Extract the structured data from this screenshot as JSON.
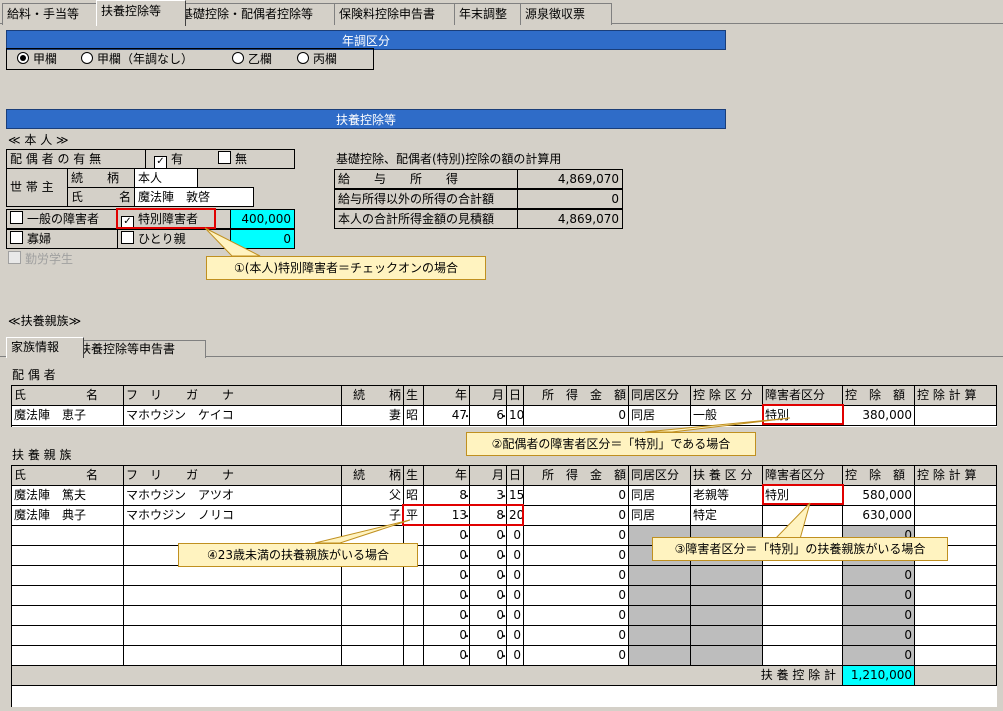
{
  "tabs": [
    "給料・手当等",
    "扶養控除等",
    "基礎控除・配偶者控除等",
    "保険料控除申告書",
    "年末調整",
    "源泉徴収票"
  ],
  "nenchou": {
    "header": "年調区分",
    "options": [
      "甲欄",
      "甲欄（年調なし）",
      "乙欄",
      "丙欄"
    ],
    "selected": "甲欄"
  },
  "fuyo_header": "扶養控除等",
  "honnin": {
    "section": "≪ 本 人 ≫",
    "spouse_label": "配 偶 者 の 有 無",
    "spouse_yes": "有",
    "spouse_no": "無",
    "setainushi": "世 帯 主",
    "zokugara_label": "続　　柄",
    "zokugara_value": "本人",
    "shimei_label": "氏　　　名",
    "shimei_value": "魔法陣　敦啓",
    "ippan_shougai": "一般の障害者",
    "tokubetsu_shougai": "特別障害者",
    "shougai_amount": "400,000",
    "kafu": "寡婦",
    "hitorioya": "ひとり親",
    "hitorioya_amount": "0",
    "kinrou": "勤労学生"
  },
  "calc": {
    "title": "基礎控除、配偶者(特別)控除の額の計算用",
    "rows": [
      {
        "label": "給　　与　　所　　得",
        "value": "4,869,070"
      },
      {
        "label": "給与所得以外の所得の合計額",
        "value": "0"
      },
      {
        "label": "本人の合計所得金額の見積額",
        "value": "4,869,070"
      }
    ]
  },
  "fuyo_shinzoku": "≪扶養親族≫",
  "subtabs": [
    "家族情報",
    "扶養控除等申告書"
  ],
  "spouse_section": {
    "title": "配 偶 者",
    "headers": [
      "氏　　　　　名",
      "フ　リ　　ガ　　ナ",
      "続　　柄",
      "生",
      "年",
      "月",
      "日",
      "所　得　金　額",
      "同居区分",
      "控 除 区 分",
      "障害者区分",
      "控　除　額",
      "控 除 計 算"
    ],
    "row": {
      "name": "魔法陣　恵子",
      "kana": "マホウジン　ケイコ",
      "rel": "妻",
      "era": "昭",
      "y": "47",
      "m": "6",
      "d": "10",
      "income": "0",
      "dokyo": "同居",
      "kubun": "一般",
      "shougai": "特別",
      "amount": "380,000",
      "calc": ""
    }
  },
  "dependents": {
    "title": "扶 養 親 族",
    "headers": [
      "氏　　　　　名",
      "フ　リ　　ガ　　ナ",
      "続　　柄",
      "生",
      "年",
      "月",
      "日",
      "所　得　金　額",
      "同居区分",
      "扶 養 区 分",
      "障害者区分",
      "控　除　額",
      "控 除 計 算"
    ],
    "rows": [
      {
        "name": "魔法陣　篤夫",
        "kana": "マホウジン　アツオ",
        "rel": "父",
        "era": "昭",
        "y": "8",
        "m": "3",
        "d": "15",
        "income": "0",
        "dokyo": "同居",
        "kubun": "老親等",
        "shougai": "特別",
        "amount": "580,000"
      },
      {
        "name": "魔法陣　典子",
        "kana": "マホウジン　ノリコ",
        "rel": "子",
        "era": "平",
        "y": "13",
        "m": "8",
        "d": "20",
        "income": "0",
        "dokyo": "同居",
        "kubun": "特定",
        "shougai": "",
        "amount": "630,000"
      },
      {
        "name": "",
        "kana": "",
        "rel": "",
        "era": "",
        "y": "0",
        "m": "0",
        "d": "0",
        "income": "0",
        "dokyo": "",
        "kubun": "",
        "shougai": "",
        "amount": "0"
      },
      {
        "name": "",
        "kana": "",
        "rel": "",
        "era": "",
        "y": "0",
        "m": "0",
        "d": "0",
        "income": "0",
        "dokyo": "",
        "kubun": "",
        "shougai": "",
        "amount": "0"
      },
      {
        "name": "",
        "kana": "",
        "rel": "",
        "era": "",
        "y": "0",
        "m": "0",
        "d": "0",
        "income": "0",
        "dokyo": "",
        "kubun": "",
        "shougai": "",
        "amount": "0"
      },
      {
        "name": "",
        "kana": "",
        "rel": "",
        "era": "",
        "y": "0",
        "m": "0",
        "d": "0",
        "income": "0",
        "dokyo": "",
        "kubun": "",
        "shougai": "",
        "amount": "0"
      },
      {
        "name": "",
        "kana": "",
        "rel": "",
        "era": "",
        "y": "0",
        "m": "0",
        "d": "0",
        "income": "0",
        "dokyo": "",
        "kubun": "",
        "shougai": "",
        "amount": "0"
      },
      {
        "name": "",
        "kana": "",
        "rel": "",
        "era": "",
        "y": "0",
        "m": "0",
        "d": "0",
        "income": "0",
        "dokyo": "",
        "kubun": "",
        "shougai": "",
        "amount": "0"
      },
      {
        "name": "",
        "kana": "",
        "rel": "",
        "era": "",
        "y": "0",
        "m": "0",
        "d": "0",
        "income": "0",
        "dokyo": "",
        "kubun": "",
        "shougai": "",
        "amount": "0"
      }
    ],
    "total_label": "扶 養 控 除 計",
    "total": "1,210,000"
  },
  "callouts": [
    "①(本人)特別障害者＝チェックオンの場合",
    "②配偶者の障害者区分＝「特別」である場合",
    "③障害者区分＝「特別」の扶養親族がいる場合",
    "④23歳未満の扶養親族がいる場合"
  ],
  "colors": {
    "header_blue": "#2f6cc8",
    "highlight_cyan": "#00ffff",
    "callout_red": "#e00000",
    "callout_bg": "#fff3c0"
  }
}
